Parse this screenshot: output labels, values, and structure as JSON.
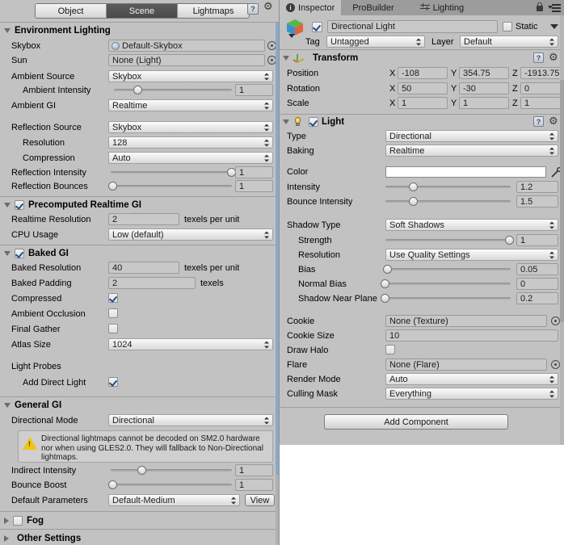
{
  "window": {
    "bg_color": "#c2c2c2",
    "accent_color": "#4a4a4a"
  },
  "lighting_panel": {
    "tabs": [
      {
        "label": "Object",
        "selected": false
      },
      {
        "label": "Scene",
        "selected": true
      },
      {
        "label": "Lightmaps",
        "selected": false
      }
    ],
    "toolbar_icons": [
      "help-icon",
      "gear-icon"
    ],
    "sections": [
      {
        "id": "environment_lighting",
        "title": "Environment Lighting",
        "expanded": true,
        "rows": [
          {
            "type": "object",
            "label": "Skybox",
            "value": "Default-Skybox",
            "has_picker": true,
            "icon": "material-sphere-icon"
          },
          {
            "type": "object",
            "label": "Sun",
            "value": "None (Light)",
            "has_picker": true
          },
          {
            "type": "dropdown",
            "label": "Ambient Source",
            "value": "Skybox"
          },
          {
            "type": "slider",
            "label": "Ambient Intensity",
            "value": "1",
            "fill": 0.2,
            "indent": true
          },
          {
            "type": "dropdown",
            "label": "Ambient GI",
            "value": "Realtime"
          },
          {
            "type": "gap"
          },
          {
            "type": "dropdown",
            "label": "Reflection Source",
            "value": "Skybox"
          },
          {
            "type": "dropdown",
            "label": "Resolution",
            "value": "128",
            "indent": true
          },
          {
            "type": "dropdown",
            "label": "Compression",
            "value": "Auto",
            "indent": true
          },
          {
            "type": "slider",
            "label": "Reflection Intensity",
            "value": "1",
            "fill": 1.0
          },
          {
            "type": "slider",
            "label": "Reflection Bounces",
            "value": "1",
            "fill": 0.0
          }
        ]
      },
      {
        "id": "precomputed_realtime_gi",
        "title": "Precomputed Realtime GI",
        "expanded": true,
        "checkbox": true,
        "checked": true,
        "rows": [
          {
            "type": "number_suffix",
            "label": "Realtime Resolution",
            "value": "2",
            "suffix": "texels per unit"
          },
          {
            "type": "dropdown",
            "label": "CPU Usage",
            "value": "Low (default)"
          }
        ]
      },
      {
        "id": "baked_gi",
        "title": "Baked GI",
        "expanded": true,
        "checkbox": true,
        "checked": true,
        "rows": [
          {
            "type": "number_suffix",
            "label": "Baked Resolution",
            "value": "40",
            "suffix": "texels per unit"
          },
          {
            "type": "number_suffix",
            "label": "Baked Padding",
            "value": "2",
            "suffix": "texels",
            "narrow": true
          },
          {
            "type": "checkbox",
            "label": "Compressed",
            "checked": true
          },
          {
            "type": "checkbox",
            "label": "Ambient Occlusion",
            "checked": false
          },
          {
            "type": "checkbox",
            "label": "Final Gather",
            "checked": false
          },
          {
            "type": "dropdown",
            "label": "Atlas Size",
            "value": "1024"
          },
          {
            "type": "gap"
          },
          {
            "type": "plainlabel",
            "label": "Light Probes"
          },
          {
            "type": "checkbox",
            "label": "Add Direct Light",
            "checked": true,
            "indent": true
          }
        ]
      },
      {
        "id": "general_gi",
        "title": "General GI",
        "expanded": true,
        "rows": [
          {
            "type": "dropdown",
            "label": "Directional Mode",
            "value": "Directional"
          },
          {
            "type": "helpbox",
            "text": "Directional lightmaps cannot be decoded on SM2.0 hardware nor when using GLES2.0. They will fallback to Non-Directional lightmaps."
          },
          {
            "type": "slider",
            "label": "Indirect Intensity",
            "value": "1",
            "fill": 0.25
          },
          {
            "type": "slider",
            "label": "Bounce Boost",
            "value": "1",
            "fill": 0.0
          },
          {
            "type": "dropdown_button",
            "label": "Default Parameters",
            "value": "Default-Medium",
            "button": "View"
          }
        ]
      },
      {
        "id": "fog",
        "title": "Fog",
        "expanded": false,
        "checkbox": true,
        "checked": false,
        "rows": []
      },
      {
        "id": "other_settings",
        "title": "Other Settings",
        "expanded": false,
        "rows": []
      }
    ]
  },
  "inspector": {
    "tabs": [
      {
        "label": "Inspector",
        "icon": "info-icon",
        "selected": true
      },
      {
        "label": "ProBuilder",
        "icon": "",
        "selected": false
      },
      {
        "label": "Lighting",
        "icon": "lighting-icon",
        "selected": false
      }
    ],
    "lock_icon": "lock-icon",
    "menu_icon": "hamburger-menu-icon",
    "object_header": {
      "icon": "gameobject-cube-icon",
      "enabled": true,
      "name": "Directional Light",
      "static_label": "Static",
      "static_checked": false,
      "tag_label": "Tag",
      "tag_value": "Untagged",
      "layer_label": "Layer",
      "layer_value": "Default"
    },
    "components": [
      {
        "id": "transform",
        "title": "Transform",
        "icon": "transform-axis-icon",
        "expanded": true,
        "rows": [
          {
            "type": "vector3",
            "label": "Position",
            "x": "-108",
            "y": "354.75",
            "z": "-1913.75"
          },
          {
            "type": "vector3",
            "label": "Rotation",
            "x": "50",
            "y": "-30",
            "z": "0"
          },
          {
            "type": "vector3",
            "label": "Scale",
            "x": "1",
            "y": "1",
            "z": "1"
          }
        ]
      },
      {
        "id": "light",
        "title": "Light",
        "icon": "light-bulb-icon",
        "expanded": true,
        "checkbox": true,
        "checked": true,
        "rows": [
          {
            "type": "dropdown",
            "label": "Type",
            "value": "Directional"
          },
          {
            "type": "dropdown",
            "label": "Baking",
            "value": "Realtime"
          },
          {
            "type": "gap"
          },
          {
            "type": "color",
            "label": "Color",
            "value": "#ffffff",
            "eyedropper": true
          },
          {
            "type": "slider",
            "label": "Intensity",
            "value": "1.2",
            "fill": 0.22
          },
          {
            "type": "slider",
            "label": "Bounce Intensity",
            "value": "1.5",
            "fill": 0.22
          },
          {
            "type": "gap"
          },
          {
            "type": "dropdown",
            "label": "Shadow Type",
            "value": "Soft Shadows"
          },
          {
            "type": "slider",
            "label": "Strength",
            "value": "1",
            "fill": 1.0,
            "indent": true
          },
          {
            "type": "dropdown",
            "label": "Resolution",
            "value": "Use Quality Settings",
            "indent": true
          },
          {
            "type": "slider",
            "label": "Bias",
            "value": "0.05",
            "fill": 0.05,
            "indent": true
          },
          {
            "type": "slider",
            "label": "Normal Bias",
            "value": "0",
            "fill": 0.0,
            "indent": true
          },
          {
            "type": "slider",
            "label": "Shadow Near Plane",
            "value": "0.2",
            "fill": 0.0,
            "indent": true
          },
          {
            "type": "gap"
          },
          {
            "type": "object",
            "label": "Cookie",
            "value": "None (Texture)",
            "has_picker": true
          },
          {
            "type": "number_wide",
            "label": "Cookie Size",
            "value": "10"
          },
          {
            "type": "checkbox",
            "label": "Draw Halo",
            "checked": false
          },
          {
            "type": "object",
            "label": "Flare",
            "value": "None (Flare)",
            "has_picker": true
          },
          {
            "type": "dropdown",
            "label": "Render Mode",
            "value": "Auto"
          },
          {
            "type": "dropdown",
            "label": "Culling Mask",
            "value": "Everything"
          }
        ]
      }
    ],
    "add_component_label": "Add Component"
  }
}
